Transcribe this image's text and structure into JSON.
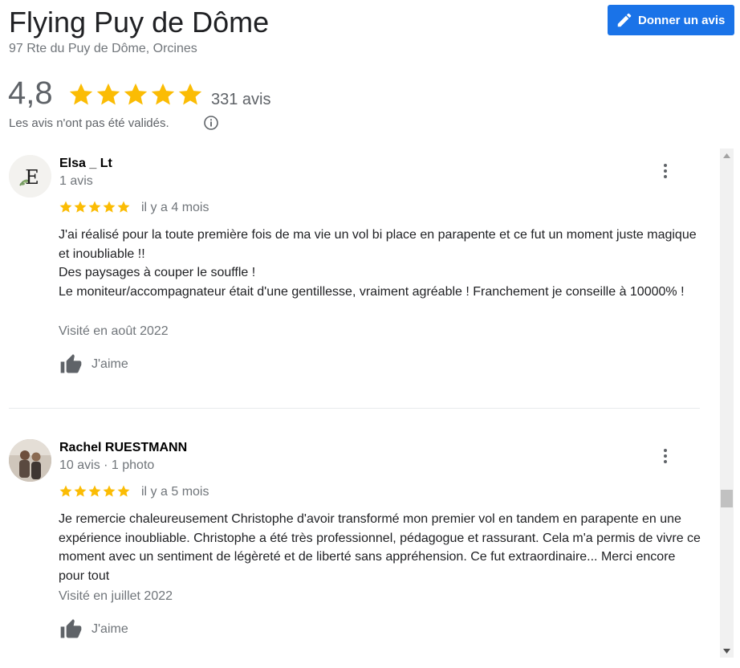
{
  "place": {
    "name": "Flying Puy de Dôme",
    "address": "97 Rte du Puy de Dôme, Orcines"
  },
  "write_review_button": {
    "label": "Donner un avis",
    "icon": "pencil-icon"
  },
  "summary": {
    "rating": "4,8",
    "rating_value": 4.8,
    "count": "331 avis",
    "notice": "Les avis n'ont pas été validés."
  },
  "reviews": [
    {
      "author": "Elsa _ Lt",
      "meta": "1 avis",
      "stars": 5,
      "when": "il y a 4 mois",
      "lines": [
        "J'ai réalisé pour la toute première fois de ma vie un vol bi place en parapente et ce fut un moment juste magique et inoubliable !!",
        "Des paysages à couper le souffle !",
        "Le moniteur/accompagnateur était d'une gentillesse, vraiment agréable ! Franchement je conseille à 10000% !"
      ],
      "visited": "Visité en août 2022",
      "like_label": "J'aime",
      "avatar_letter": "E"
    },
    {
      "author": "Rachel RUESTMANN",
      "meta": "10 avis · 1 photo",
      "stars": 5,
      "when": "il y a 5 mois",
      "text": "Je remercie chaleureusement Christophe d'avoir transformé mon premier vol en tandem en parapente en une expérience inoubliable. Christophe a été très professionnel, pédagogue et  rassurant. Cela m'a permis de vivre ce moment avec un sentiment de légèreté et de liberté sans appréhension. Ce fut extraordinaire... Merci encore pour tout",
      "visited": "Visité en juillet 2022",
      "like_label": "J'aime"
    }
  ],
  "colors": {
    "accent": "#1a73e8",
    "star": "#fbbc04",
    "secondary_text": "#70757a"
  }
}
